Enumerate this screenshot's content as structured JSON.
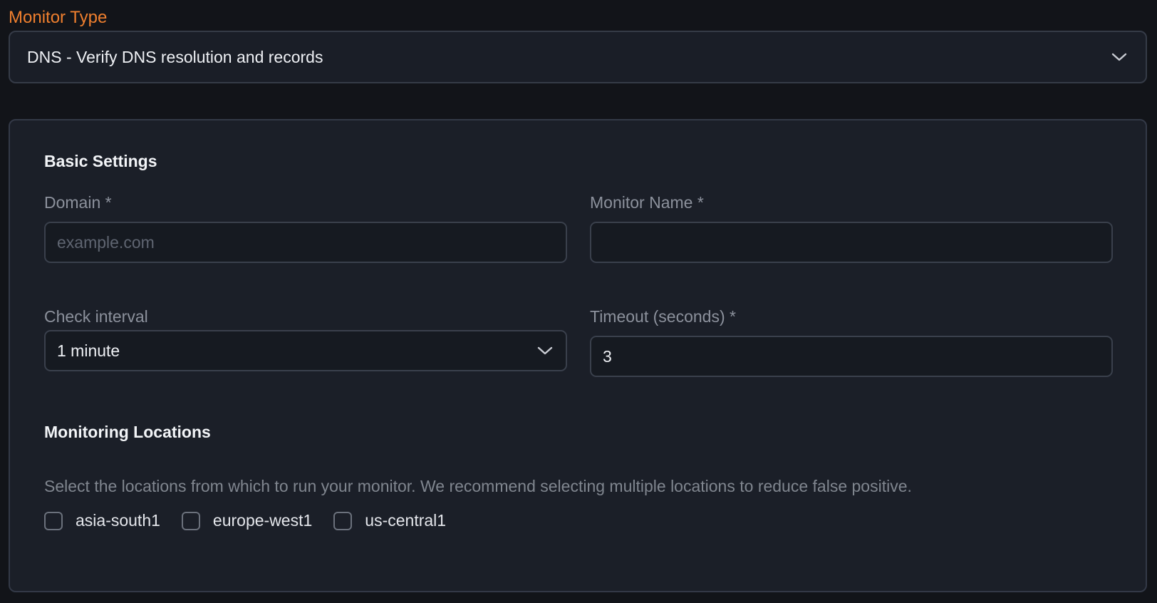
{
  "monitor_type": {
    "label": "Monitor Type",
    "selected": "DNS - Verify DNS resolution and records",
    "icon": "chevron-down-icon"
  },
  "basic_settings": {
    "title": "Basic Settings",
    "domain": {
      "label": "Domain *",
      "value": "",
      "placeholder": "example.com"
    },
    "monitor_name": {
      "label": "Monitor Name *",
      "value": "",
      "placeholder": ""
    },
    "check_interval": {
      "label": "Check interval",
      "selected": "1 minute",
      "icon": "chevron-down-icon"
    },
    "timeout": {
      "label": "Timeout (seconds) *",
      "value": "3"
    }
  },
  "monitoring_locations": {
    "title": "Monitoring Locations",
    "help": "Select the locations from which to run your monitor. We recommend selecting multiple locations to reduce false positive.",
    "options": [
      {
        "label": "asia-south1",
        "checked": false
      },
      {
        "label": "europe-west1",
        "checked": false
      },
      {
        "label": "us-central1",
        "checked": false
      }
    ]
  },
  "colors": {
    "accent": "#ef7f2e",
    "background": "#121419",
    "panel": "#1b1f28",
    "border": "#333947"
  }
}
